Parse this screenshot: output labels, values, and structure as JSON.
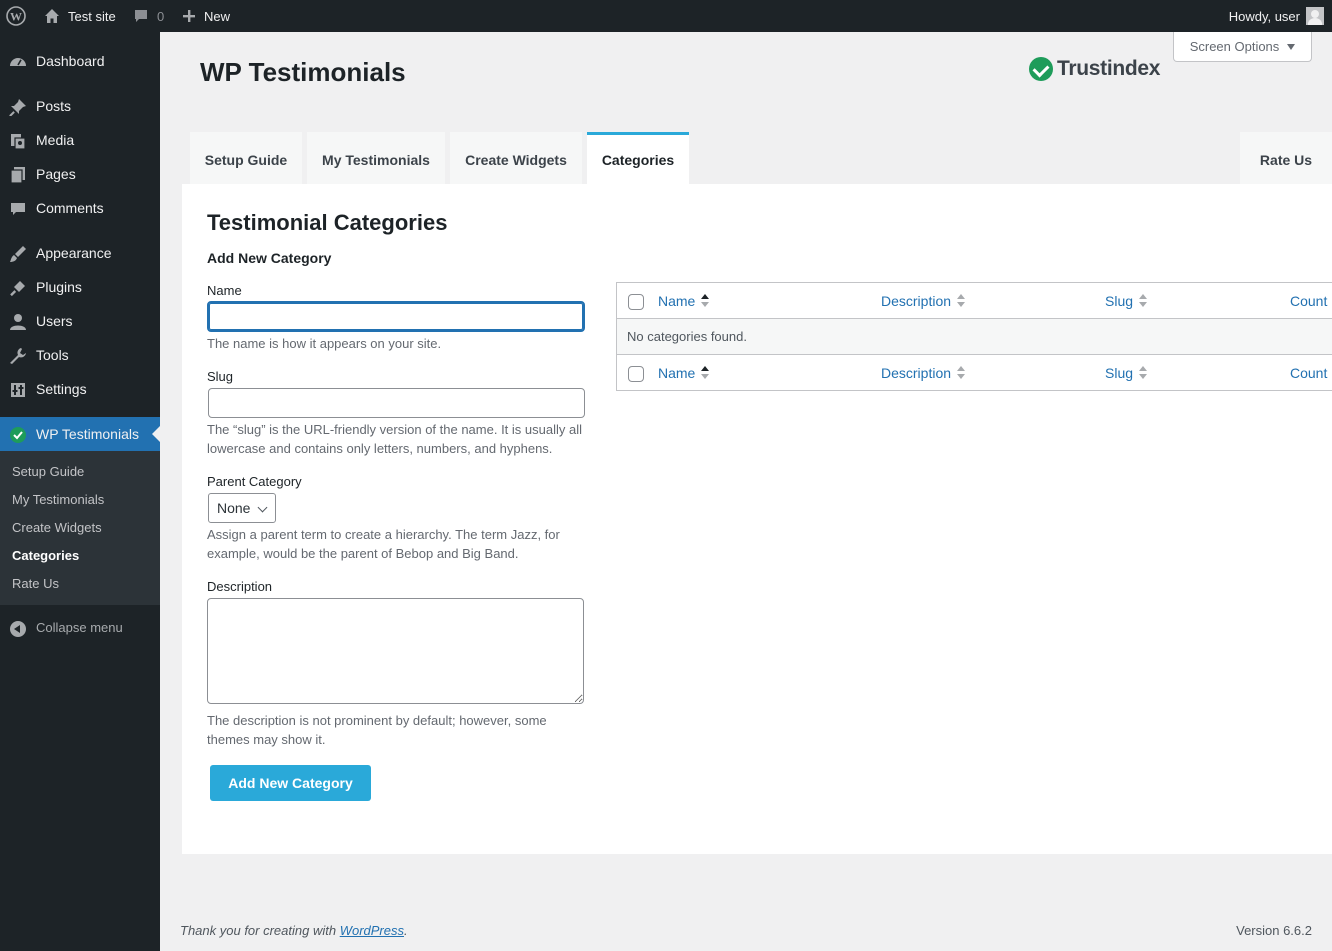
{
  "adminbar": {
    "site_name": "Test site",
    "comments_count": "0",
    "new_label": "New",
    "howdy": "Howdy, user"
  },
  "sidebar": {
    "items": [
      {
        "label": "Dashboard",
        "icon": "dashboard-icon"
      },
      {
        "label": "Posts",
        "icon": "pin-icon"
      },
      {
        "label": "Media",
        "icon": "media-icon"
      },
      {
        "label": "Pages",
        "icon": "pages-icon"
      },
      {
        "label": "Comments",
        "icon": "comment-icon"
      },
      {
        "label": "Appearance",
        "icon": "brush-icon"
      },
      {
        "label": "Plugins",
        "icon": "plug-icon"
      },
      {
        "label": "Users",
        "icon": "user-icon"
      },
      {
        "label": "Tools",
        "icon": "wrench-icon"
      },
      {
        "label": "Settings",
        "icon": "settings-icon"
      },
      {
        "label": "WP Testimonials",
        "icon": "check-circle-icon"
      }
    ],
    "submenu": [
      "Setup Guide",
      "My Testimonials",
      "Create Widgets",
      "Categories",
      "Rate Us"
    ],
    "submenu_current": "Categories",
    "collapse_label": "Collapse menu"
  },
  "header": {
    "title": "WP Testimonials",
    "brand": "Trustindex",
    "screen_options": "Screen Options"
  },
  "tabs": [
    "Setup Guide",
    "My Testimonials",
    "Create Widgets",
    "Categories",
    "Rate Us"
  ],
  "active_tab": "Categories",
  "main": {
    "title": "Testimonial Categories",
    "form_title": "Add New Category",
    "name_label": "Name",
    "name_value": "",
    "name_help": "The name is how it appears on your site.",
    "slug_label": "Slug",
    "slug_value": "",
    "slug_help": "The “slug” is the URL-friendly version of the name. It is usually all lowercase and contains only letters, numbers, and hyphens.",
    "parent_label": "Parent Category",
    "parent_value": "None",
    "parent_help": "Assign a parent term to create a hierarchy. The term Jazz, for example, would be the parent of Bebop and Big Band.",
    "description_label": "Description",
    "description_value": "",
    "description_help": "The description is not prominent by default; however, some themes may show it.",
    "submit_label": "Add New Category"
  },
  "table": {
    "columns": [
      "Name",
      "Description",
      "Slug",
      "Count"
    ],
    "empty_message": "No categories found."
  },
  "footer": {
    "thanks_prefix": "Thank you for creating with ",
    "thanks_link": "WordPress",
    "thanks_suffix": ".",
    "version": "Version 6.6.2"
  },
  "colors": {
    "admin_dark": "#1d2327",
    "accent_blue": "#2271b1",
    "brand_cyan": "#2aa9d9",
    "trustindex_green": "#1e9c5a"
  }
}
